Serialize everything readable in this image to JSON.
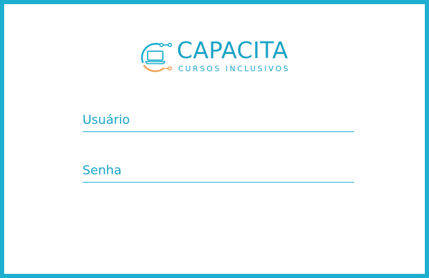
{
  "brand": {
    "title": "CAPACITA",
    "subtitle": "CURSOS INCLUSIVOS",
    "logo_icon": "laptop-circuit-icon",
    "colors": {
      "primary": "#1eaecf",
      "accent": "#f2a65a"
    }
  },
  "form": {
    "username_label": "Usuário",
    "username_value": "",
    "password_label": "Senha",
    "password_value": ""
  }
}
